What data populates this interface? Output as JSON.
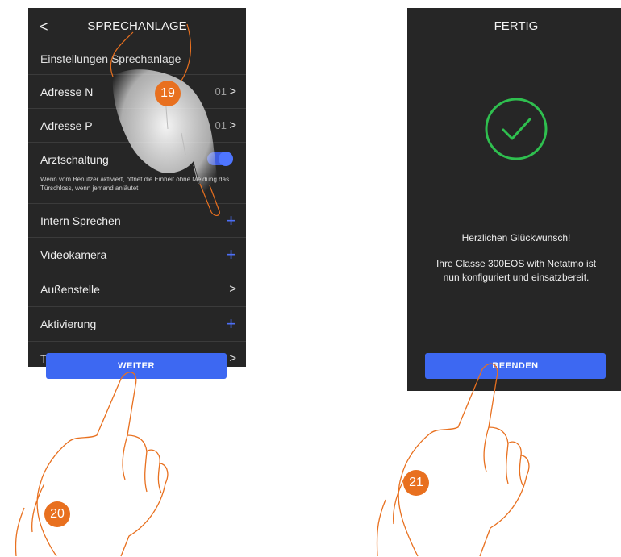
{
  "left": {
    "title": "SPRECHANLAGE",
    "back": "<",
    "section_title": "Einstellungen Sprechanlage",
    "rows": {
      "adresse_n": {
        "label": "Adresse N",
        "value": "01"
      },
      "adresse_p": {
        "label": "Adresse P",
        "value": "01"
      },
      "arzt": {
        "label": "Arztschaltung",
        "hint": "Wenn vom Benutzer aktiviert, öffnet die Einheit ohne Meldung das Türschloss, wenn jemand anläutet"
      },
      "intern": {
        "label": "Intern Sprechen"
      },
      "video": {
        "label": "Videokamera"
      },
      "aussen": {
        "label": "Außenstelle"
      },
      "aktiv": {
        "label": "Aktivierung"
      },
      "last": {
        "label": "T"
      }
    },
    "button": "WEITER"
  },
  "right": {
    "title": "FERTIG",
    "congrats": "Herzlichen Glückwunsch!",
    "message_line1": "Ihre Classe 300EOS with Netatmo ist",
    "message_line2": "nun konfiguriert und einsatzbereit.",
    "button": "BEENDEN"
  },
  "steps": {
    "s19": "19",
    "s20": "20",
    "s21": "21"
  },
  "colors": {
    "accent": "#3d68f2",
    "badge": "#e8701f",
    "check": "#2fbf4f",
    "screen": "#262626"
  }
}
